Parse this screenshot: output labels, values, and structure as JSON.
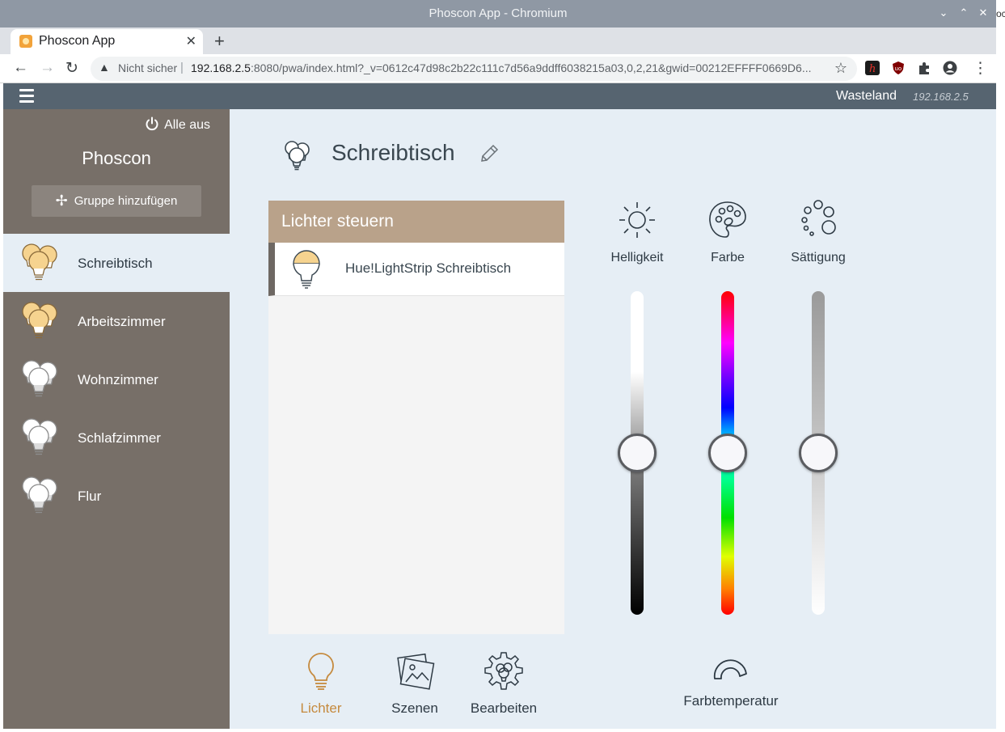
{
  "window": {
    "title": "Phoscon App - Chromium",
    "edge_text": "oc"
  },
  "browser": {
    "tab_title": "Phoscon App",
    "omnibox": {
      "security_label": "Nicht sicher",
      "separator": "|",
      "host": "192.168.2.5",
      "url_rest": ":8080/pwa/index.html?_v=0612c47d98c2b22c111c7d56a9ddff6038215a03,0,2,21&gwid=00212EFFFF0669D6..."
    }
  },
  "header": {
    "gateway_name": "Wasteland",
    "gateway_ip": "192.168.2.5"
  },
  "sidebar": {
    "all_off_label": "Alle aus",
    "brand": "Phoscon",
    "add_group_label": "Gruppe hinzufügen",
    "groups": [
      {
        "label": "Schreibtisch",
        "active": true,
        "state": "on"
      },
      {
        "label": "Arbeitszimmer",
        "active": false,
        "state": "on"
      },
      {
        "label": "Wohnzimmer",
        "active": false,
        "state": "off"
      },
      {
        "label": "Schlafzimmer",
        "active": false,
        "state": "off"
      },
      {
        "label": "Flur",
        "active": false,
        "state": "off"
      }
    ]
  },
  "main": {
    "group_title": "Schreibtisch",
    "lights_panel": {
      "header": "Lichter steuern",
      "lights": [
        {
          "name": "Hue!LightStrip Schreibtisch"
        }
      ]
    },
    "controls": [
      {
        "label": "Helligkeit",
        "icon": "sun-icon",
        "level": 0.5
      },
      {
        "label": "Farbe",
        "icon": "palette-icon",
        "level": 0.5
      },
      {
        "label": "Sättigung",
        "icon": "saturation-dots-icon",
        "level": 0.5
      }
    ],
    "bottom_nav": [
      {
        "label": "Lichter",
        "icon": "bulb-icon",
        "active": true
      },
      {
        "label": "Szenen",
        "icon": "scenes-icon",
        "active": false
      },
      {
        "label": "Bearbeiten",
        "icon": "gear-bulbs-icon",
        "active": false
      }
    ],
    "color_temperature_label": "Farbtemperatur"
  },
  "colors": {
    "sidebar_bg": "#776f68",
    "main_bg": "#e6eef5",
    "appbar_bg": "#566470",
    "panel_header_bg": "#b9a28a",
    "accent_active": "#c58a3e"
  }
}
